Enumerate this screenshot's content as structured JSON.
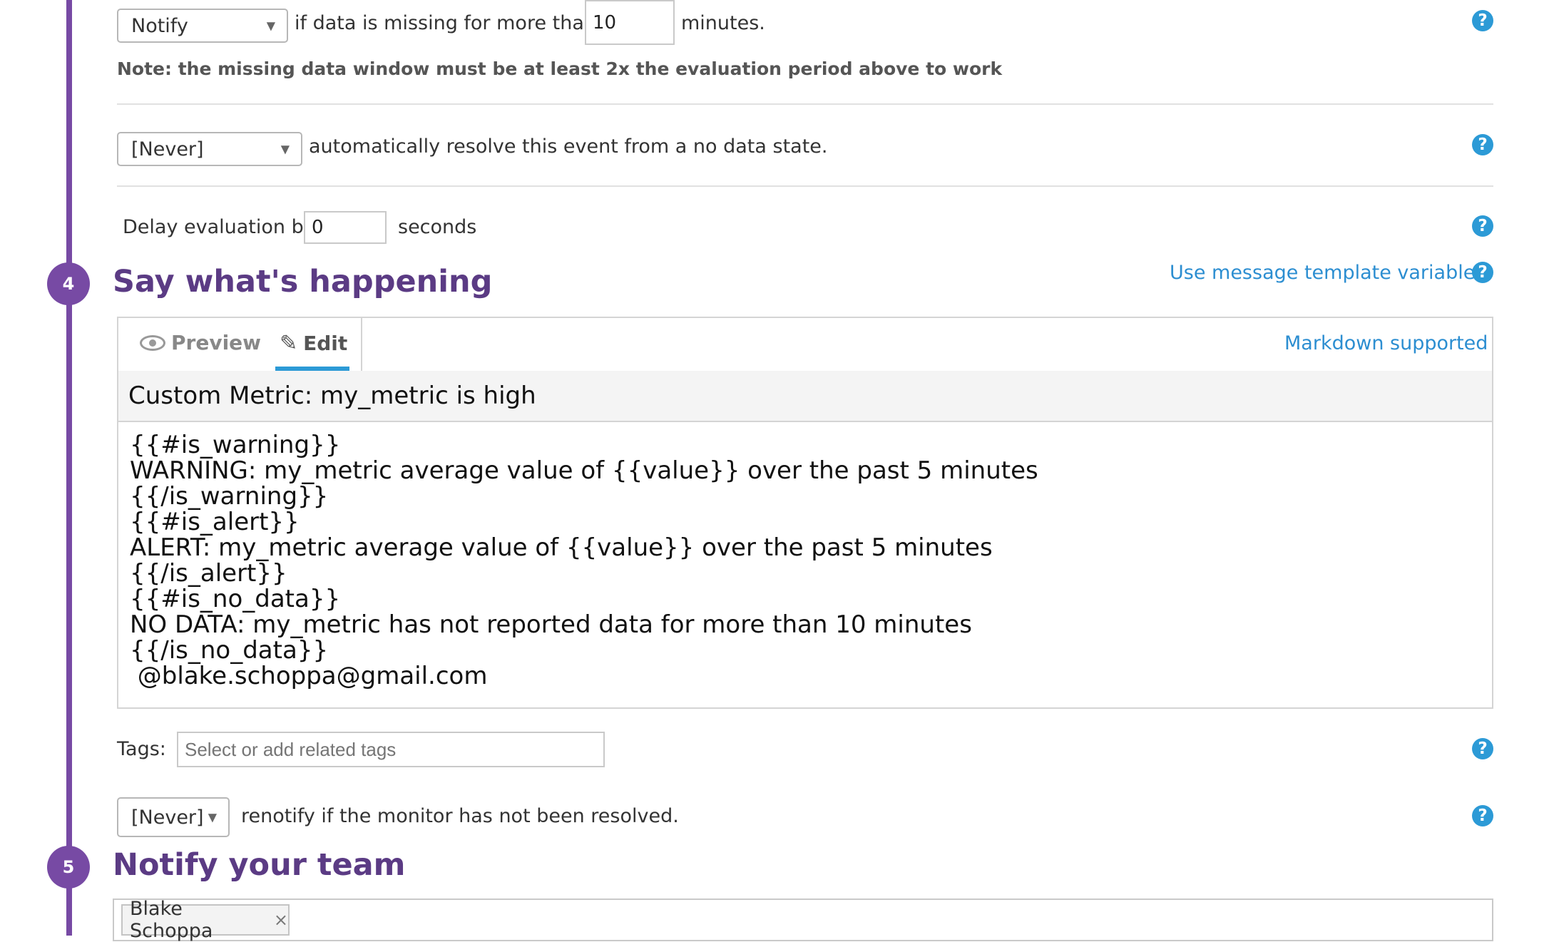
{
  "missing_data": {
    "action": "Notify",
    "text_before": "if data is missing for more than",
    "minutes_value": "10",
    "text_after": "minutes.",
    "note": "Note: the missing data window must be at least 2x the evaluation period above to work"
  },
  "auto_resolve": {
    "value": "[Never]",
    "text": "automatically resolve this event from a no data state."
  },
  "delay": {
    "label": "Delay evaluation by",
    "value": "0",
    "unit": "seconds"
  },
  "step4": {
    "number": "4",
    "title": "Say what's happening",
    "template_link": "Use message template variables"
  },
  "editor": {
    "tab_preview": "Preview",
    "tab_edit": "Edit",
    "markdown_link": "Markdown supported",
    "subject": "Custom Metric:  my_metric is high",
    "body_lines": [
      "{{#is_warning}}",
      "WARNING: my_metric average value of {{value}} over the past 5 minutes",
      "{{/is_warning}}",
      "{{#is_alert}}",
      "ALERT: my_metric average value of {{value}} over the past 5 minutes",
      "{{/is_alert}}",
      "{{#is_no_data}}",
      "NO DATA: my_metric has not reported data for more than 10 minutes",
      "{{/is_no_data}}",
      " @blake.schoppa@gmail.com"
    ]
  },
  "tags": {
    "label": "Tags:",
    "placeholder": "Select or add related tags"
  },
  "renotify": {
    "value": "[Never]",
    "text": "renotify if the monitor has not been resolved."
  },
  "step5": {
    "number": "5",
    "title": "Notify your team",
    "recipient": "Blake Schoppa",
    "remove_glyph": "×"
  },
  "help_glyph": "?",
  "colors": {
    "accent_purple": "#774aa4",
    "title_purple": "#5b3b84",
    "link_blue": "#2c8ed1",
    "help_blue": "#2c9ad6",
    "tab_underline": "#2c9ad6"
  }
}
